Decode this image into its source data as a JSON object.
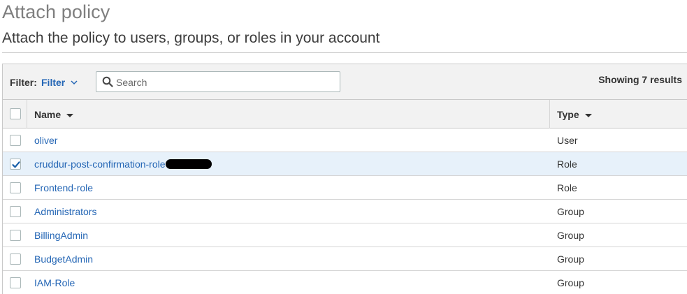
{
  "page": {
    "title": "Attach policy",
    "subtitle": "Attach the policy to users, groups, or roles in your account"
  },
  "filter": {
    "label": "Filter:",
    "dropdown_value": "Filter",
    "search_placeholder": "Search",
    "search_value": "",
    "results_text": "Showing 7 results"
  },
  "table": {
    "columns": {
      "name": "Name",
      "type": "Type"
    },
    "rows": [
      {
        "name": "oliver",
        "type": "User",
        "checked": false,
        "redacted": false
      },
      {
        "name": "cruddur-post-confirmation-role",
        "type": "Role",
        "checked": true,
        "redacted": true
      },
      {
        "name": "Frontend-role",
        "type": "Role",
        "checked": false,
        "redacted": false
      },
      {
        "name": "Administrators",
        "type": "Group",
        "checked": false,
        "redacted": false
      },
      {
        "name": "BillingAdmin",
        "type": "Group",
        "checked": false,
        "redacted": false
      },
      {
        "name": "BudgetAdmin",
        "type": "Group",
        "checked": false,
        "redacted": false
      },
      {
        "name": "IAM-Role",
        "type": "Group",
        "checked": false,
        "redacted": false
      }
    ]
  },
  "colors": {
    "link": "#2466b5",
    "selected_row": "#e7f1fa",
    "header_bg": "#f2f2f2"
  },
  "icons": {
    "search": "search-icon",
    "chevron": "chevron-down-icon",
    "sort": "sort-caret-icon",
    "check": "checkmark-icon"
  }
}
